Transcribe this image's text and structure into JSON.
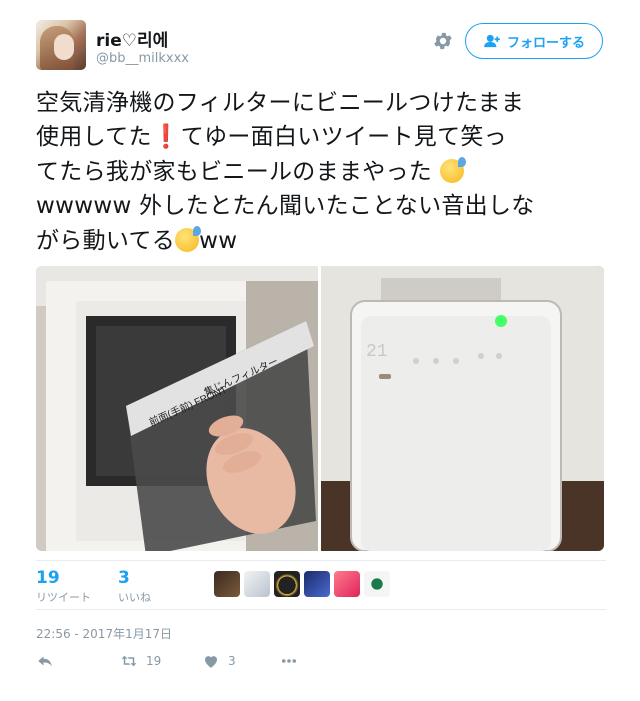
{
  "header": {
    "display_name": "rie♡리에",
    "screen_name": "@bb__milkxxx",
    "follow_label": "フォローする"
  },
  "tweet": {
    "lines": [
      "空気清浄機のフィルターにビニールつけたまま",
      "使用してた",
      "てゆー面白いツイート見て笑っ",
      "てたら我が家もビニールのままやった",
      "wwwww 外したとたん聞いたことない音出しな",
      "がら動いてる",
      "ww"
    ],
    "emoji_exclamation": "❗",
    "line2_tail": "てゆー面白いツイート見て笑っ"
  },
  "photos": {
    "left_box_label": "前面(手前) FRONT",
    "left_box_label2": "集じんフィルター",
    "right_display": "21"
  },
  "stats": {
    "retweets": "19",
    "retweets_label": "リツイート",
    "likes": "3",
    "likes_label": "いいね"
  },
  "timestamp": "22:56 - 2017年1月17日",
  "actions": {
    "retweet_count": "19",
    "like_count": "3"
  },
  "colors": {
    "accent": "#1da1f2",
    "muted": "#8899a6",
    "text": "#14171a"
  }
}
